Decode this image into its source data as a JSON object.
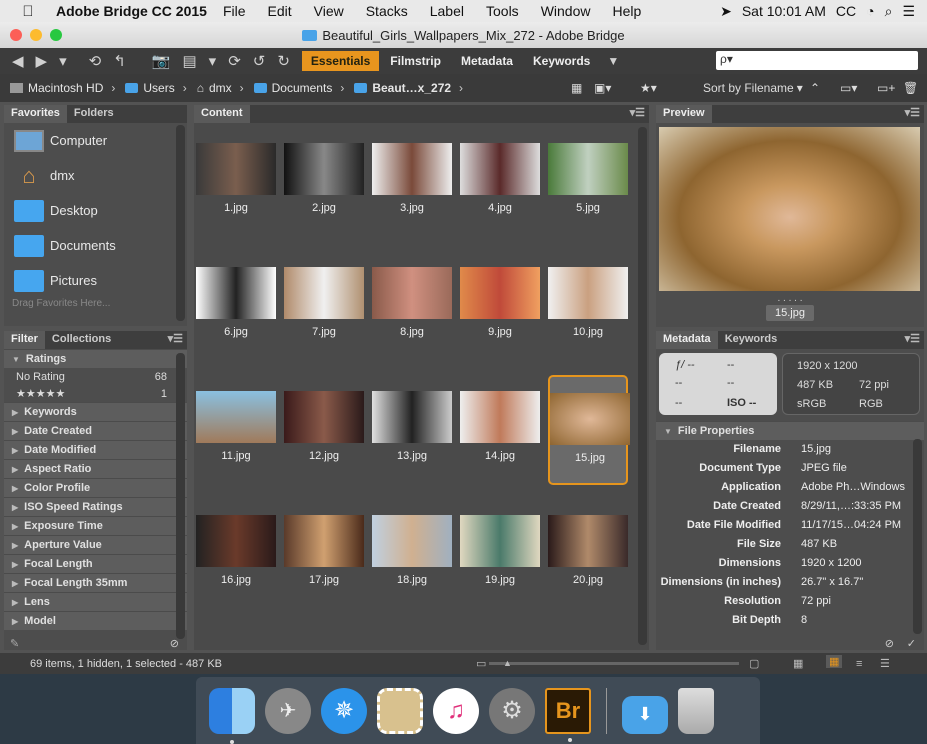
{
  "menubar": {
    "app": "Adobe Bridge CC 2015",
    "items": [
      "File",
      "Edit",
      "View",
      "Stacks",
      "Label",
      "Tools",
      "Window",
      "Help"
    ],
    "clock": "Sat 10:01 AM",
    "cc": "CC"
  },
  "window": {
    "title": "Beautiful_Girls_Wallpapers_Mix_272 - Adobe Bridge"
  },
  "workspaces": [
    "Essentials",
    "Filmstrip",
    "Metadata",
    "Keywords"
  ],
  "search": {
    "placeholder": "ρ▾"
  },
  "path": [
    "Macintosh HD",
    "Users",
    "dmx",
    "Documents",
    "Beaut…x_272"
  ],
  "sort": {
    "label": "Sort by Filename"
  },
  "favorites": {
    "tabs": [
      "Favorites",
      "Folders"
    ],
    "items": [
      "Computer",
      "dmx",
      "Desktop",
      "Documents",
      "Pictures"
    ],
    "drag_hint": "Drag Favorites Here..."
  },
  "filter": {
    "tabs": [
      "Filter",
      "Collections"
    ],
    "ratings_header": "Ratings",
    "rows": [
      {
        "label": "No Rating",
        "count": "68"
      },
      {
        "label": "★★★★★",
        "count": "1"
      }
    ],
    "categories": [
      "Keywords",
      "Date Created",
      "Date Modified",
      "Aspect Ratio",
      "Color Profile",
      "ISO Speed Ratings",
      "Exposure Time",
      "Aperture Value",
      "Focal Length",
      "Focal Length 35mm",
      "Lens",
      "Model"
    ]
  },
  "content": {
    "tab": "Content",
    "files": [
      "1.jpg",
      "2.jpg",
      "3.jpg",
      "4.jpg",
      "5.jpg",
      "6.jpg",
      "7.jpg",
      "8.jpg",
      "9.jpg",
      "10.jpg",
      "11.jpg",
      "12.jpg",
      "13.jpg",
      "14.jpg",
      "15.jpg",
      "16.jpg",
      "17.jpg",
      "18.jpg",
      "19.jpg",
      "20.jpg"
    ],
    "selected": "15.jpg"
  },
  "preview": {
    "tab": "Preview",
    "caption": "15.jpg",
    "dots": ". . . . ."
  },
  "metadata": {
    "tabs": [
      "Metadata",
      "Keywords"
    ],
    "camera": {
      "fstop": "ƒ/ --",
      "shutter": "--",
      "dash1": "--",
      "dash2": "--",
      "dash3": "--",
      "iso": "ISO --"
    },
    "summary": {
      "dimensions": "1920 x 1200",
      "size": "487 KB",
      "resolution": "72 ppi",
      "space": "sRGB",
      "mode": "RGB"
    },
    "section": "File Properties",
    "rows": [
      {
        "k": "Filename",
        "v": "15.jpg"
      },
      {
        "k": "Document Type",
        "v": "JPEG file"
      },
      {
        "k": "Application",
        "v": "Adobe Ph…Windows"
      },
      {
        "k": "Date Created",
        "v": "8/29/11,…:33:35 PM"
      },
      {
        "k": "Date File Modified",
        "v": "11/17/15…04:24 PM"
      },
      {
        "k": "File Size",
        "v": "487 KB"
      },
      {
        "k": "Dimensions",
        "v": "1920 x 1200"
      },
      {
        "k": "Dimensions (in inches)",
        "v": "26.7\" x 16.7\""
      },
      {
        "k": "Resolution",
        "v": "72 ppi"
      },
      {
        "k": "Bit Depth",
        "v": "8"
      }
    ]
  },
  "status": {
    "text": "69 items, 1 hidden, 1 selected - 487 KB"
  },
  "dock": {
    "br": "Br"
  }
}
